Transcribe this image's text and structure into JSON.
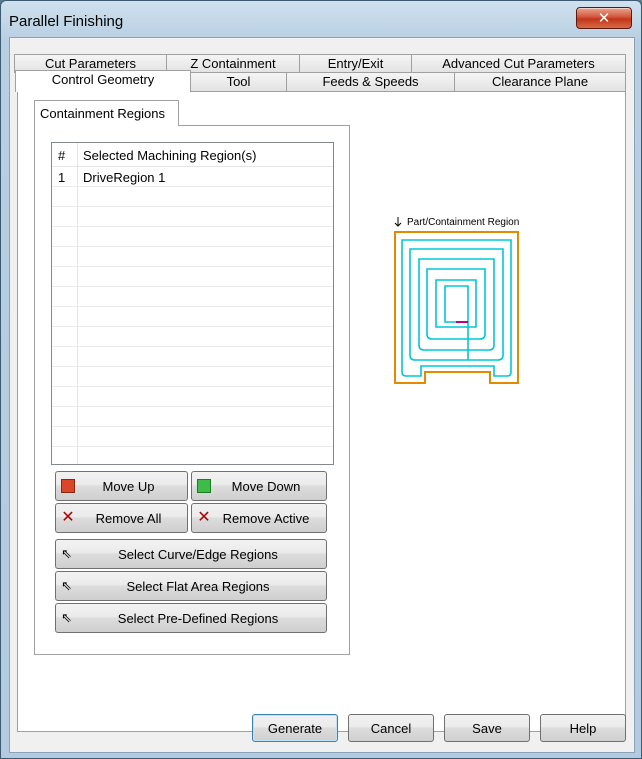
{
  "window": {
    "title": "Parallel Finishing",
    "close_glyph": "✕"
  },
  "tabs": {
    "row1": [
      "Cut Parameters",
      "Z Containment",
      "Entry/Exit",
      "Advanced Cut Parameters"
    ],
    "row2": [
      "Control Geometry",
      "Tool",
      "Feeds & Speeds",
      "Clearance Plane"
    ],
    "active": "Control Geometry"
  },
  "group": {
    "title": "Containment Regions"
  },
  "list": {
    "columns": [
      "#",
      "Selected Machining Region(s)"
    ],
    "rows": [
      {
        "num": "1",
        "name": "DriveRegion 1"
      }
    ]
  },
  "buttons": {
    "move_up": "Move Up",
    "move_down": "Move Down",
    "remove_all": "Remove All",
    "remove_active": "Remove Active",
    "select_curve": "Select Curve/Edge Regions",
    "select_flat": "Select Flat Area Regions",
    "select_predefined": "Select Pre-Defined Regions"
  },
  "preview": {
    "label": "Part/Containment Region",
    "colors": {
      "boundary": "#e38a00",
      "toolpath": "#00c8d6",
      "marker": "#c0007a"
    }
  },
  "footer": {
    "generate": "Generate",
    "cancel": "Cancel",
    "save": "Save",
    "help": "Help"
  }
}
